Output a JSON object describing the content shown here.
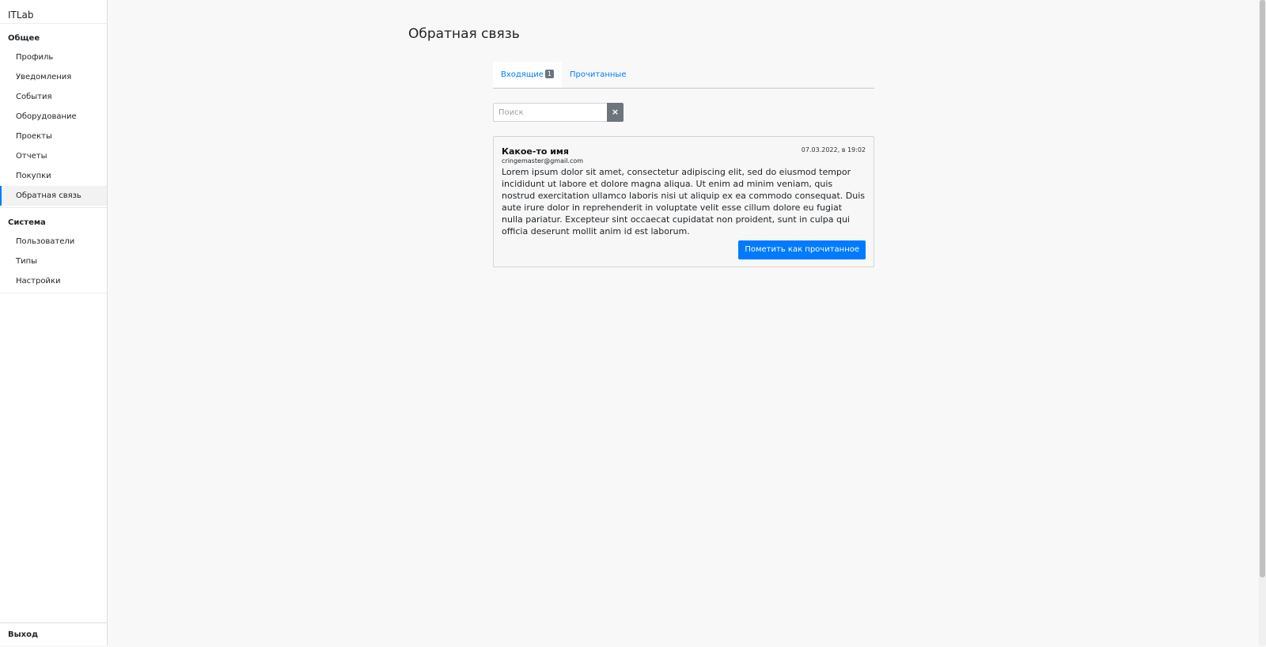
{
  "sidebar": {
    "brand": "ITLab",
    "sections": [
      {
        "title": "Общее",
        "items": [
          {
            "label": "Профиль"
          },
          {
            "label": "Уведомления"
          },
          {
            "label": "События"
          },
          {
            "label": "Оборудование"
          },
          {
            "label": "Проекты"
          },
          {
            "label": "Отчеты"
          },
          {
            "label": "Покупки"
          },
          {
            "label": "Обратная связь",
            "active": true
          }
        ]
      },
      {
        "title": "Система",
        "items": [
          {
            "label": "Пользователи"
          },
          {
            "label": "Типы"
          },
          {
            "label": "Настройки"
          }
        ]
      }
    ],
    "logout_label": "Выход"
  },
  "main": {
    "title": "Обратная связь",
    "tabs": [
      {
        "label": "Входящие",
        "badge": "1",
        "active": true
      },
      {
        "label": "Прочитанные"
      }
    ],
    "search": {
      "placeholder": "Поиск",
      "value": "",
      "clear_icon": "×"
    },
    "messages": [
      {
        "name": "Какое-то имя",
        "email": "cringemaster@gmail.com",
        "date": "07.03.2022, в 19:02",
        "text": "Lorem ipsum dolor sit amet, consectetur adipiscing elit, sed do eiusmod tempor incididunt ut labore et dolore magna aliqua. Ut enim ad minim veniam, quis nostrud exercitation ullamco laboris nisi ut aliquip ex ea commodo consequat. Duis aute irure dolor in reprehenderit in voluptate velit esse cillum dolore eu fugiat nulla pariatur. Excepteur sint occaecat cupidatat non proident, sunt in culpa qui officia deserunt mollit anim id est laborum.",
        "action_label": "Пометить как прочитанное"
      }
    ]
  },
  "colors": {
    "accent": "#007bff",
    "badge": "#6c757d",
    "background": "#f8f8f8"
  }
}
